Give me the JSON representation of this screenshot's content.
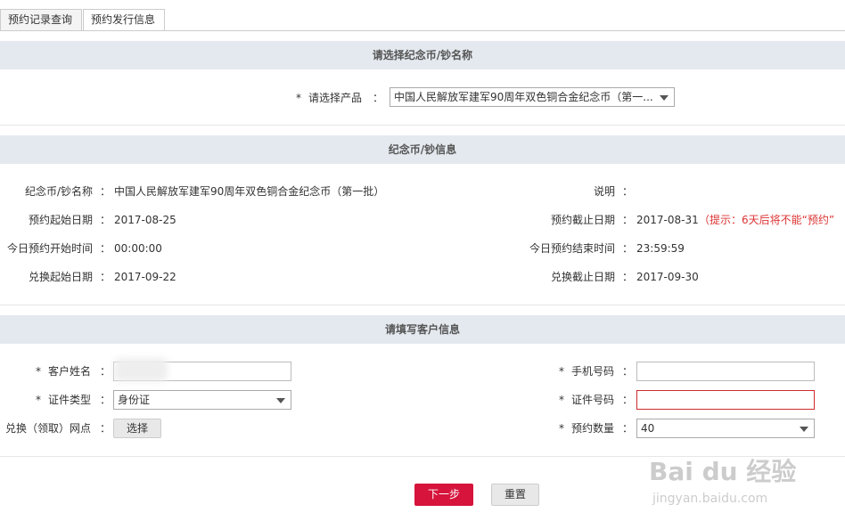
{
  "tabs": [
    "预约记录查询",
    "预约发行信息"
  ],
  "section1": {
    "title": "请选择纪念币/钞名称",
    "product_label": "请选择产品",
    "product_value": "中国人民解放军建军90周年双色铜合金纪念币（第一..."
  },
  "section2": {
    "title": "纪念币/钞信息",
    "fields": {
      "name": {
        "label": "纪念币/钞名称",
        "value": "中国人民解放军建军90周年双色铜合金纪念币（第一批）"
      },
      "desc": {
        "label": "说明",
        "value": ""
      },
      "start_date": {
        "label": "预约起始日期",
        "value": "2017-08-25"
      },
      "end_date": {
        "label": "预约截止日期",
        "value": "2017-08-31",
        "hint": "（提示：6天后将不能“预约”"
      },
      "today_start": {
        "label": "今日预约开始时间",
        "value": "00:00:00"
      },
      "today_end": {
        "label": "今日预约结束时间",
        "value": "23:59:59"
      },
      "exchange_start": {
        "label": "兑换起始日期",
        "value": "2017-09-22"
      },
      "exchange_end": {
        "label": "兑换截止日期",
        "value": "2017-09-30"
      }
    }
  },
  "section3": {
    "title": "请填写客户信息",
    "customer_name_label": "客户姓名",
    "phone_label": "手机号码",
    "id_type_label": "证件类型",
    "id_type_value": "身份证",
    "id_number_label": "证件号码",
    "branch_label": "兑换（领取）网点",
    "select_button": "选择",
    "quantity_label": "预约数量",
    "quantity_value": "40"
  },
  "actions": {
    "next": "下一步",
    "reset": "重置"
  },
  "colon": "：",
  "required_mark": "*",
  "watermark": {
    "brand": "Bai du 经验",
    "url": "jingyan.baidu.com"
  },
  "colors": {
    "band": "#e4e9ef",
    "primary_button": "#d6143c",
    "hint": "#dd3333",
    "error_border": "#d02b2b"
  }
}
